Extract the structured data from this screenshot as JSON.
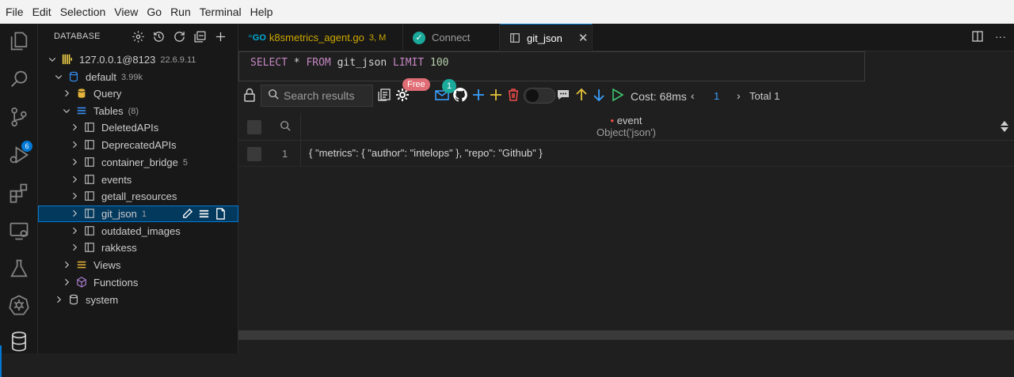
{
  "menu": [
    "File",
    "Edit",
    "Selection",
    "View",
    "Go",
    "Run",
    "Terminal",
    "Help"
  ],
  "activity_bar": {
    "icons": [
      "explorer-icon",
      "search-icon",
      "source-control-icon",
      "run-debug-icon",
      "extensions-icon",
      "remote-explorer-icon",
      "testing-icon",
      "kubernetes-icon",
      "database-icon"
    ],
    "scm_badge": "6"
  },
  "sidebar": {
    "title": "DATABASE",
    "connection": {
      "label": "127.0.0.1@8123",
      "version": "22.6.9.11"
    },
    "database": {
      "label": "default",
      "size": "3.99k"
    },
    "query_label": "Query",
    "tables": {
      "label": "Tables",
      "count": "(8)"
    },
    "table_items": [
      {
        "label": "DeletedAPIs",
        "count": ""
      },
      {
        "label": "DeprecatedAPIs",
        "count": ""
      },
      {
        "label": "container_bridge",
        "count": "5"
      },
      {
        "label": "events",
        "count": ""
      },
      {
        "label": "getall_resources",
        "count": ""
      },
      {
        "label": "git_json",
        "count": "1"
      },
      {
        "label": "outdated_images",
        "count": ""
      },
      {
        "label": "rakkess",
        "count": ""
      }
    ],
    "views_label": "Views",
    "functions_label": "Functions",
    "system_label": "system"
  },
  "tabs": [
    {
      "label": "k8smetrics_agent.go",
      "code": "3, M"
    },
    {
      "label": "Connect"
    },
    {
      "label": "git_json"
    }
  ],
  "editor": {
    "sql": {
      "select": "SELECT",
      "star": "*",
      "from": "FROM",
      "table": "git_json",
      "limit": "LIMIT",
      "limit_value": "100"
    }
  },
  "toolbar": {
    "search_placeholder": "Search results",
    "free_badge": "Free",
    "count_badge": "1",
    "cost": "Cost: 68ms",
    "prev": "‹",
    "page": "1",
    "next": "›",
    "total": "Total 1"
  },
  "grid": {
    "column_name": "event",
    "column_type": "Object('json')",
    "rows": [
      {
        "num": "1",
        "value": "{ \"metrics\": { \"author\": \"intelops\" }, \"repo\": \"Github\" }"
      }
    ]
  },
  "colors": {
    "accent": "#0078d4",
    "keyword": "#c586c0",
    "number": "#b5cea8",
    "go": "#00add8",
    "badge_red": "#e06c75",
    "badge_teal": "#1aa99a"
  }
}
